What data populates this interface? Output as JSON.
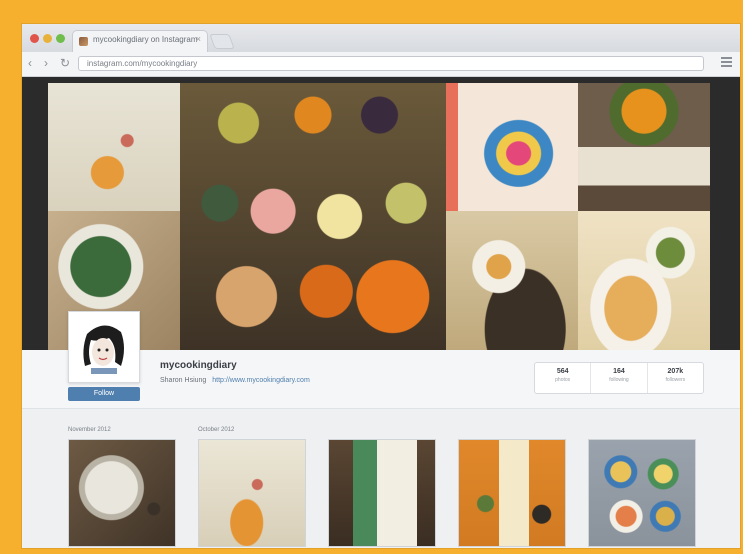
{
  "browser": {
    "tab_title": "mycookingdiary on Instagram",
    "tab_close": "×",
    "address": "instagram.com/mycookingdiary",
    "nav": {
      "back": "‹",
      "forward": "›",
      "reload": "↻"
    }
  },
  "profile": {
    "username": "mycookingdiary",
    "full_name": "Sharon Hsiung",
    "website": "http://www.mycookingdiary.com",
    "follow_label": "Follow",
    "stats": [
      {
        "value": "564",
        "label": "photos"
      },
      {
        "value": "164",
        "label": "following"
      },
      {
        "value": "207k",
        "label": "followers"
      }
    ]
  },
  "timeline": {
    "months": [
      "November 2012",
      "October 2012"
    ]
  },
  "colors": {
    "frame": "#F6B02E",
    "button": "#4f7fae",
    "link": "#4f7fae"
  },
  "icons": [
    "back-icon",
    "forward-icon",
    "reload-icon",
    "menu-icon",
    "favicon-icon"
  ]
}
